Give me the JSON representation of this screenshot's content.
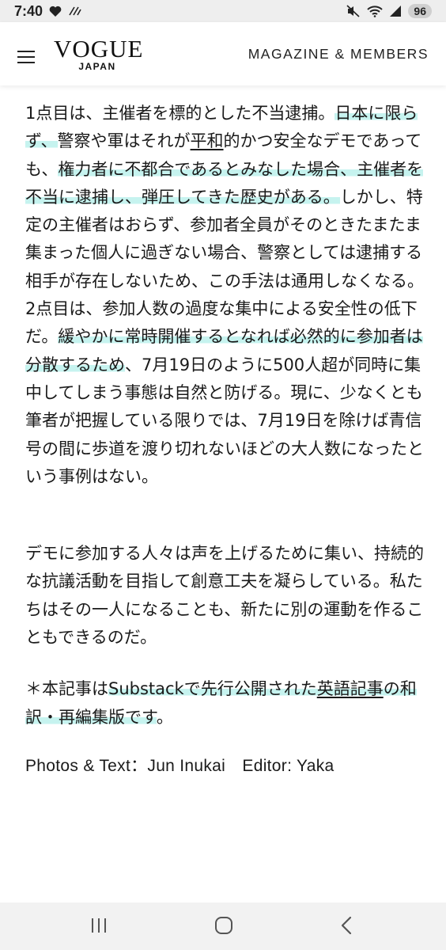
{
  "status_bar": {
    "time": "7:40",
    "battery": "96",
    "icons": [
      "heart-icon",
      "cast-icon",
      "mute-icon",
      "wifi-icon",
      "signal-icon"
    ]
  },
  "header": {
    "logo_main": "VOGUE",
    "logo_sub": "JAPAN",
    "nav_link": "MAGAZINE & MEMBERS",
    "menu_icon": "hamburger-menu-icon"
  },
  "article": {
    "p1": {
      "s1": "1点目は、主催者を標的とした不当逮捕。",
      "s2": "日本に限らず、",
      "s3": "警察や軍はそれが",
      "s4": "平和",
      "s5": "的かつ安全なデモであっても、",
      "s6": "権力者に不都合であるとみなした場合、主催者を不当に逮捕し、弾圧してきた歴史がある。",
      "s7": "しかし、特定の主催者はおらず、参加者全員がそのときたまたま集まった個人に過ぎない場合、警察としては逮捕する相手が存在しないため、この手法は通用しなくなる。2点目は、参加人数の過度な集中による安全性の低下だ。",
      "s8": "緩やかに常時開催するとなれば必然的に参加者は分散するため",
      "s9": "、7月19日のように500人超が同時に集中してしまう事態は自然と防げる。現に、少なくとも筆者が把握している限りでは、7月19日を除けば青信号の間に歩道を渡り切れないほどの大人数になったという事例はない。"
    },
    "p2": "デモに参加する人々は声を上げるために集い、持続的な抗議活動を目指して創意工夫を凝らしている。私たちはその一人になることも、新たに別の運動を作ることもできるのだ。",
    "p3": {
      "s1": "＊本記事は",
      "s2": "Substackで先行公開された",
      "s3": "英語記事",
      "s4": "の和訳・再編集版です",
      "s5": "。"
    },
    "credit": "Photos & Text：Jun Inukai　Editor: Yaka",
    "highlight_color": "#c6f3ef"
  },
  "nav": {
    "recent_icon": "recent-apps-icon",
    "home_icon": "home-icon",
    "back_icon": "back-icon"
  }
}
